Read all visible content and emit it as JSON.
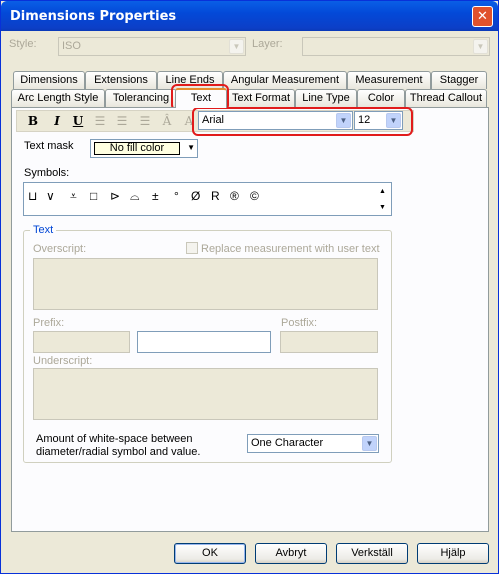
{
  "window": {
    "title": "Dimensions Properties",
    "close_glyph": "✕"
  },
  "header": {
    "style_label": "Style:",
    "style_value": "ISO",
    "layer_label": "Layer:",
    "layer_value": ""
  },
  "tabs_row1": [
    "Dimensions",
    "Extensions",
    "Line Ends",
    "Angular Measurement",
    "Measurement",
    "Stagger"
  ],
  "tabs_row2": [
    "Arc Length Style",
    "Tolerancing",
    "Text",
    "Text Format",
    "Line Type",
    "Color",
    "Thread Callout"
  ],
  "active_tab": "Text",
  "toolbar": {
    "bold": "B",
    "italic": "I",
    "underline": "U",
    "font_value": "Arial",
    "size_value": "12",
    "tools": [
      "bold-icon",
      "italic-icon",
      "underline-icon",
      "align-left-icon",
      "align-center-icon",
      "align-right-icon",
      "text-size-icon",
      "text-rotate-icon"
    ]
  },
  "text_mask": {
    "label": "Text mask",
    "value": "No fill color"
  },
  "symbols": {
    "label": "Symbols:",
    "items": [
      "⊔",
      "∨",
      "⩡",
      "□",
      "⊳",
      "⌓",
      "±",
      "°",
      "Ø",
      "R",
      "®",
      "©"
    ]
  },
  "text_group": {
    "title": "Text",
    "overscript_label": "Overscript:",
    "replace_label": "Replace measurement with user text",
    "prefix_label": "Prefix:",
    "postfix_label": "Postfix:",
    "underscript_label": "Underscript:",
    "whitespace_label_1": "Amount of white-space between",
    "whitespace_label_2": "diameter/radial symbol and value.",
    "whitespace_value": "One Character"
  },
  "buttons": {
    "ok": "OK",
    "cancel": "Avbryt",
    "apply": "Verkställ",
    "help": "Hjälp"
  },
  "colors": {
    "accent": "#0a5fe6",
    "highlight": "#e11b1b",
    "tab_active": "#e68b2c"
  }
}
